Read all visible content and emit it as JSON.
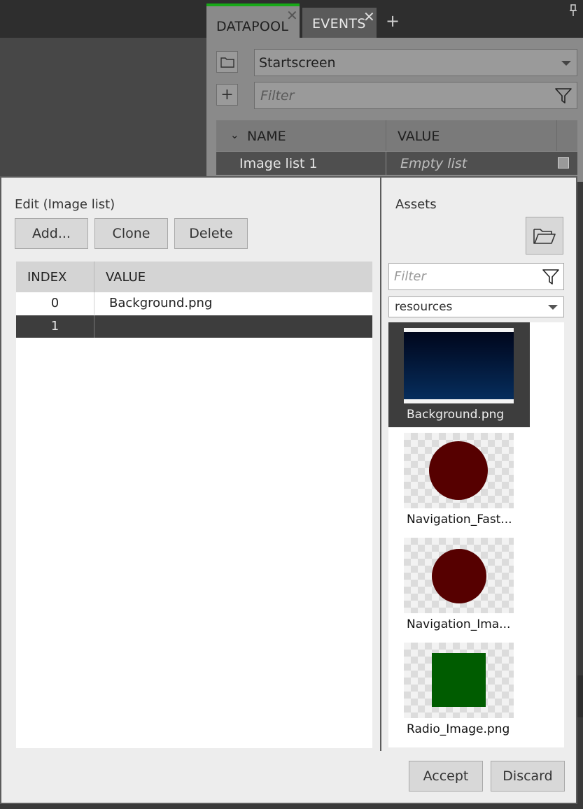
{
  "datapool": {
    "tabs": [
      {
        "label": "DATAPOOL",
        "active": true
      },
      {
        "label": "EVENTS",
        "active": false
      }
    ],
    "add_tab_symbol": "+",
    "scope_selected": "Startscreen",
    "filter_placeholder": "Filter",
    "columns": {
      "name": "NAME",
      "value": "VALUE"
    },
    "row": {
      "name": "Image list 1",
      "value": "Empty list"
    }
  },
  "editor": {
    "title": "Edit  (Image list)",
    "buttons": {
      "add": "Add...",
      "clone": "Clone",
      "delete": "Delete"
    },
    "columns": {
      "index": "INDEX",
      "value": "VALUE"
    },
    "rows": [
      {
        "index": "0",
        "value": "Background.png",
        "selected": false
      },
      {
        "index": "1",
        "value": "",
        "selected": true
      }
    ],
    "accept_label": "Accept",
    "discard_label": "Discard"
  },
  "assets": {
    "title": "Assets",
    "filter_placeholder": "Filter",
    "folder_selected": "resources",
    "items": [
      {
        "label": "Background.png",
        "kind": "background",
        "selected": true
      },
      {
        "label": "Navigation_Fast...",
        "kind": "red-circle",
        "selected": false
      },
      {
        "label": "Navigation_Ima...",
        "kind": "red-circle",
        "selected": false
      },
      {
        "label": "Radio_Image.png",
        "kind": "green-square",
        "selected": false
      }
    ]
  },
  "colors": {
    "active_tab_accent": "#17a817",
    "selection": "#3d3d3d",
    "dialog_bg": "#ededed"
  }
}
